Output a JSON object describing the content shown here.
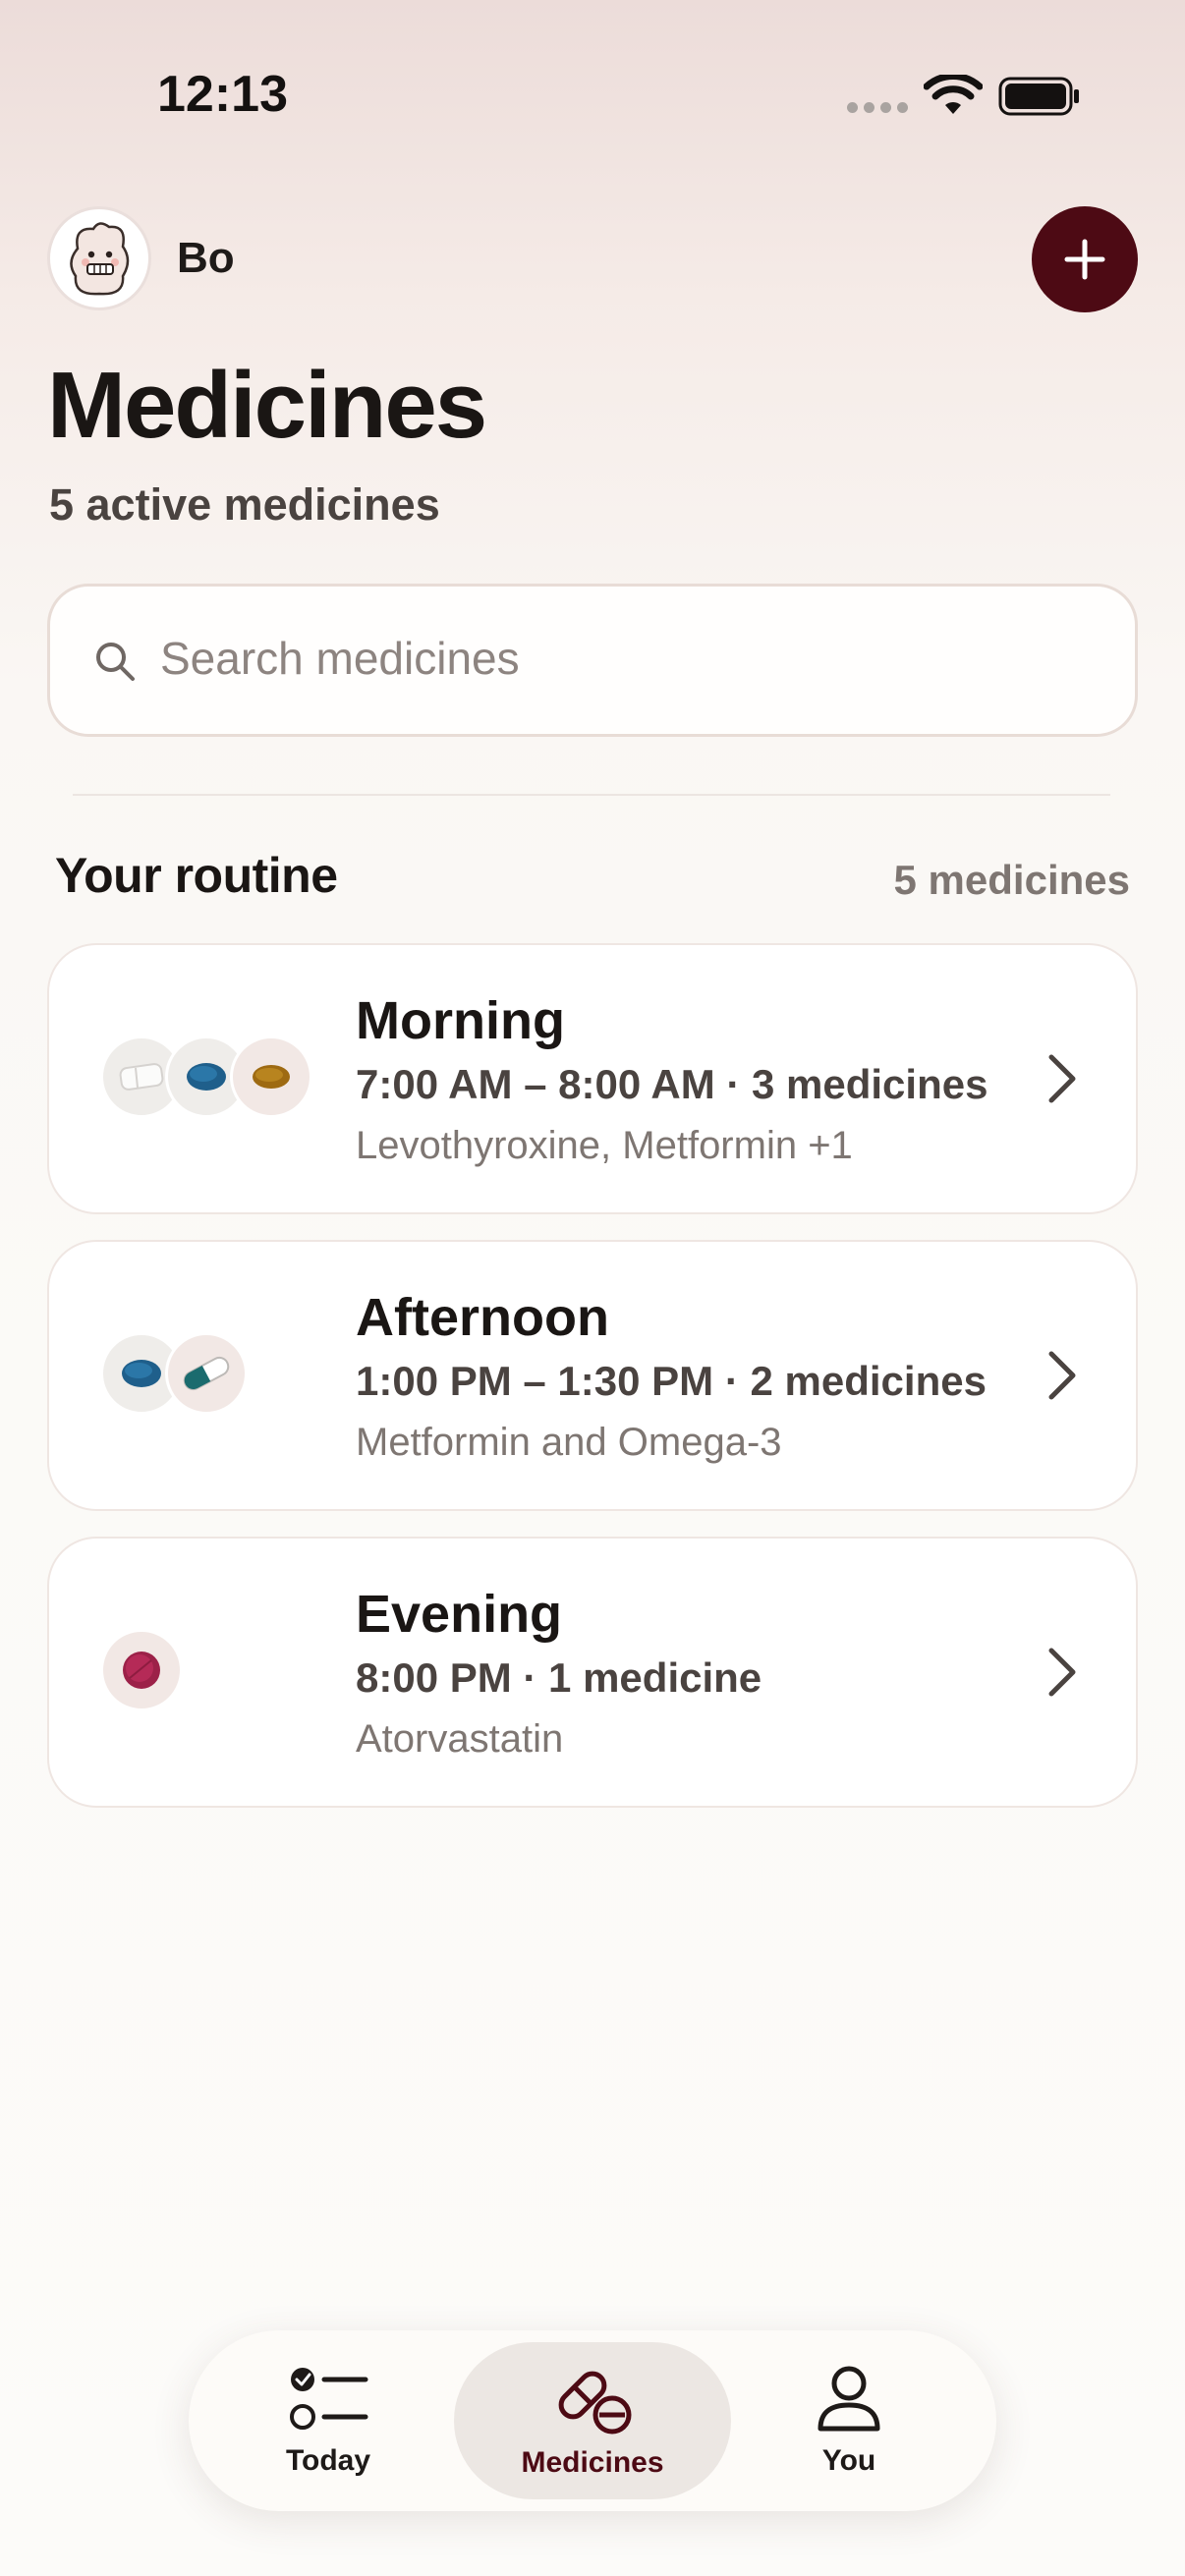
{
  "status_bar": {
    "time": "12:13"
  },
  "header": {
    "user_name": "Bo",
    "title": "Medicines",
    "subtitle": "5 active medicines",
    "add_icon": "plus-icon"
  },
  "search": {
    "placeholder": "Search medicines",
    "value": ""
  },
  "routine": {
    "title": "Your routine",
    "count": "5 medicines",
    "items": [
      {
        "name": "Morning",
        "detail": "7:00 AM – 8:00 AM · 3 medicines",
        "medicines": "Levothyroxine, Metformin +1",
        "pills": [
          "white-tablet",
          "blue-tablet",
          "amber-tablet"
        ]
      },
      {
        "name": "Afternoon",
        "detail": "1:00 PM – 1:30 PM · 2 medicines",
        "medicines": "Metformin and Omega-3",
        "pills": [
          "blue-tablet",
          "teal-capsule"
        ]
      },
      {
        "name": "Evening",
        "detail": "8:00 PM · 1 medicine",
        "medicines": "Atorvastatin",
        "pills": [
          "magenta-tablet"
        ]
      }
    ]
  },
  "tabbar": {
    "tabs": [
      {
        "label": "Today",
        "icon": "checklist-icon",
        "active": false
      },
      {
        "label": "Medicines",
        "icon": "pills-icon",
        "active": true
      },
      {
        "label": "You",
        "icon": "person-icon",
        "active": false
      }
    ]
  },
  "colors": {
    "accent": "#4d0a14",
    "background": "#faf7f4",
    "card": "#ffffff",
    "text_primary": "#1a1614",
    "text_secondary": "#7e7672"
  }
}
